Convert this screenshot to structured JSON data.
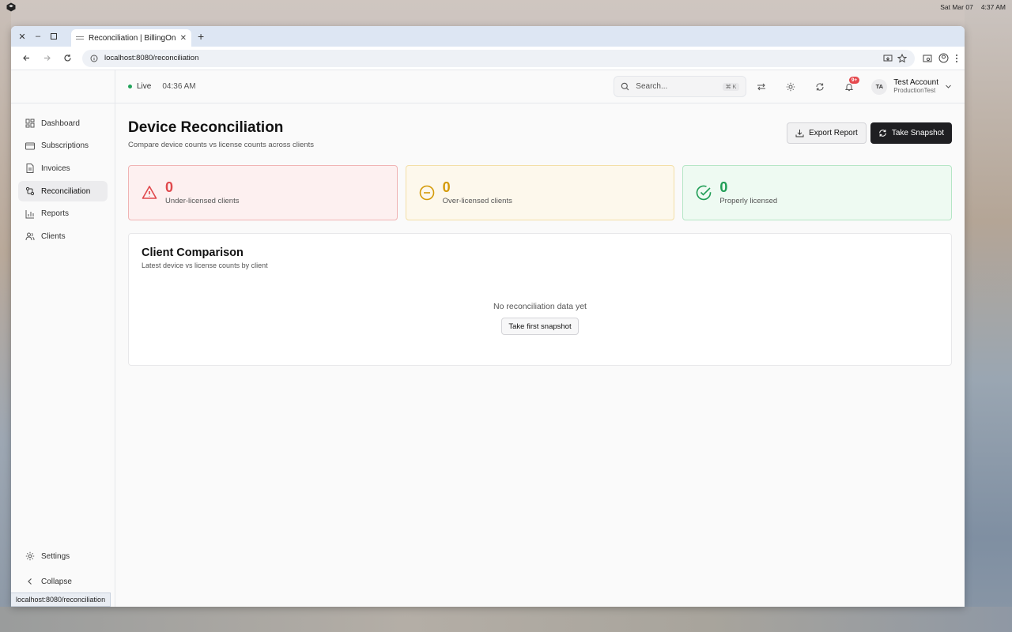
{
  "os": {
    "date": "Sat Mar 07",
    "time": "4:37 AM"
  },
  "browser": {
    "tab_title": "Reconciliation | BillingOne",
    "url": "localhost:8080/reconciliation",
    "status_url": "localhost:8080/reconciliation"
  },
  "sidebar": {
    "items": [
      {
        "label": "Dashboard"
      },
      {
        "label": "Subscriptions"
      },
      {
        "label": "Invoices"
      },
      {
        "label": "Reconciliation"
      },
      {
        "label": "Reports"
      },
      {
        "label": "Clients"
      }
    ],
    "settings_label": "Settings",
    "collapse_label": "Collapse"
  },
  "topbar": {
    "live_label": "Live",
    "time": "04:36 AM",
    "search_placeholder": "Search...",
    "search_shortcut": "⌘ K",
    "notif_badge": "9+",
    "avatar_initials": "TA",
    "account_name": "Test Account",
    "account_org": "ProductionTest"
  },
  "page": {
    "title": "Device Reconciliation",
    "subtitle": "Compare device counts vs license counts across clients",
    "export_label": "Export Report",
    "snapshot_label": "Take Snapshot"
  },
  "stats": [
    {
      "value": "0",
      "label": "Under-licensed clients",
      "color": "#e0484c"
    },
    {
      "value": "0",
      "label": "Over-licensed clients",
      "color": "#d49a08"
    },
    {
      "value": "0",
      "label": "Properly licensed",
      "color": "#1f9d55"
    }
  ],
  "comparison": {
    "title": "Client Comparison",
    "subtitle": "Latest device vs license counts by client",
    "empty_text": "No reconciliation data yet",
    "first_snapshot_label": "Take first snapshot"
  }
}
